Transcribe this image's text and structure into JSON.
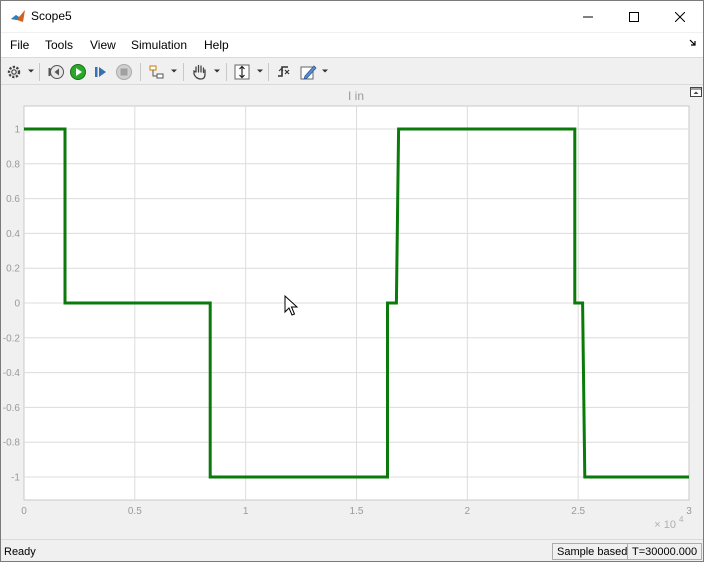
{
  "window": {
    "title": "Scope5"
  },
  "menu": [
    "File",
    "Tools",
    "View",
    "Simulation",
    "Help"
  ],
  "plot": {
    "title": "I in",
    "x_exponent_label": "× 10",
    "x_exponent": "4"
  },
  "status": {
    "left": "Ready",
    "mode": "Sample based",
    "time": "T=30000.000"
  },
  "colors": {
    "trace": "#0a7a0a",
    "plot_bg": "#ffffff",
    "grid": "#dcdcdc"
  },
  "chart_data": {
    "type": "line",
    "title": "I in",
    "xlabel": "",
    "ylabel": "",
    "xlim": [
      0,
      30000
    ],
    "ylim": [
      -1.1,
      1.1
    ],
    "x_ticks": [
      "0",
      "0.5",
      "1",
      "1.5",
      "2",
      "2.5",
      "3"
    ],
    "x_tick_values": [
      0,
      5000,
      10000,
      15000,
      20000,
      25000,
      30000
    ],
    "y_ticks": [
      "1",
      "0.8",
      "0.6",
      "0.4",
      "0.2",
      "0",
      "-0.2",
      "-0.4",
      "-0.6",
      "-0.8",
      "-1"
    ],
    "y_tick_values": [
      1,
      0.8,
      0.6,
      0.4,
      0.2,
      0,
      -0.2,
      -0.4,
      -0.6,
      -0.8,
      -1
    ],
    "grid": true,
    "series": [
      {
        "x": [
          0,
          1850,
          1850,
          8400,
          8400,
          16400,
          16400,
          16800,
          16900,
          24850,
          24850,
          25200,
          25300,
          30000
        ],
        "y": [
          1,
          1,
          0,
          0,
          -1,
          -1,
          0,
          0,
          1,
          1,
          0,
          0,
          -1,
          -1
        ]
      }
    ]
  }
}
